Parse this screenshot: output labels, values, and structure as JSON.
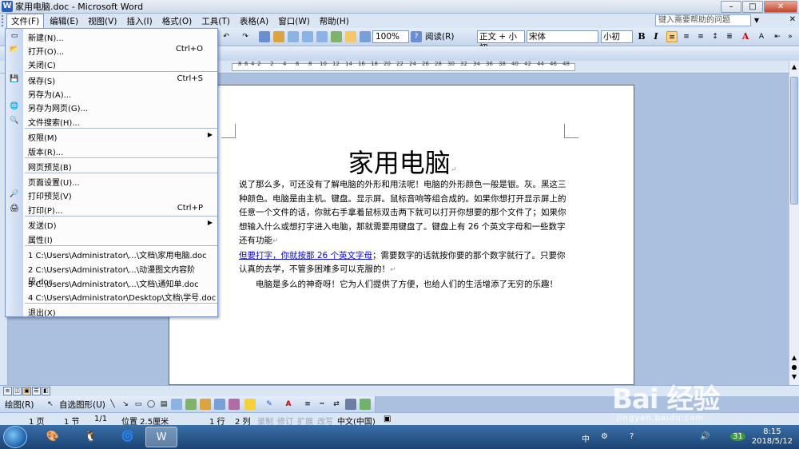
{
  "window": {
    "title": "家用电脑.doc - Microsoft Word",
    "app_icon": "W",
    "buttons": [
      "–",
      "□",
      "✕"
    ]
  },
  "menubar": {
    "items": [
      "文件(F)",
      "编辑(E)",
      "视图(V)",
      "插入(I)",
      "格式(O)",
      "工具(T)",
      "表格(A)",
      "窗口(W)",
      "帮助(H)"
    ],
    "help_placeholder": "键入需要帮助的问题"
  },
  "toolbar": {
    "zoom": "100%",
    "read_label": "阅读(R)",
    "style": "正文 + 小初",
    "font": "宋体",
    "size": "小初",
    "bold": "B",
    "italic": "I",
    "font_color": "A"
  },
  "file_menu": {
    "items": [
      {
        "label": "新建(N)...",
        "key": "",
        "icon": "new-document-icon",
        "glyph": "▭"
      },
      {
        "label": "打开(O)...",
        "key": "Ctrl+O",
        "icon": "open-folder-icon",
        "glyph": "📂"
      },
      {
        "label": "关闭(C)",
        "key": "",
        "icon": "",
        "glyph": ""
      },
      {
        "label": "保存(S)",
        "key": "Ctrl+S",
        "icon": "save-icon",
        "glyph": "💾"
      },
      {
        "label": "另存为(A)...",
        "key": "",
        "icon": "",
        "glyph": ""
      },
      {
        "label": "另存为网页(G)...",
        "key": "",
        "icon": "save-web-icon",
        "glyph": "🌐"
      },
      {
        "label": "文件搜索(H)...",
        "key": "",
        "icon": "file-search-icon",
        "glyph": "🔍"
      },
      {
        "label": "权限(M)",
        "key": "",
        "icon": "",
        "glyph": "",
        "submenu": true
      },
      {
        "label": "版本(R)...",
        "key": "",
        "icon": "",
        "glyph": ""
      },
      {
        "label": "网页预览(B)",
        "key": "",
        "icon": "",
        "glyph": ""
      },
      {
        "label": "页面设置(U)...",
        "key": "",
        "icon": "",
        "glyph": ""
      },
      {
        "label": "打印预览(V)",
        "key": "",
        "icon": "print-preview-icon",
        "glyph": "🔎"
      },
      {
        "label": "打印(P)...",
        "key": "Ctrl+P",
        "icon": "print-icon",
        "glyph": "🖨"
      },
      {
        "label": "发送(D)",
        "key": "",
        "icon": "",
        "glyph": "",
        "submenu": true
      },
      {
        "label": "属性(I)",
        "key": "",
        "icon": "",
        "glyph": ""
      },
      {
        "label": "1 C:\\Users\\Administrator\\...\\文档\\家用电脑.doc",
        "key": "",
        "icon": "",
        "glyph": ""
      },
      {
        "label": "2 C:\\Users\\Administrator\\...\\动漫图文内容阶段.doc",
        "key": "",
        "icon": "",
        "glyph": ""
      },
      {
        "label": "3 C:\\Users\\Administrator\\...\\文档\\通知单.doc",
        "key": "",
        "icon": "",
        "glyph": ""
      },
      {
        "label": "4 C:\\Users\\Administrator\\Desktop\\文档\\学号.doc",
        "key": "",
        "icon": "",
        "glyph": ""
      },
      {
        "label": "退出(X)",
        "key": "",
        "icon": "",
        "glyph": ""
      }
    ]
  },
  "ruler": {
    "numbers": [
      "8",
      "6",
      "4",
      "2",
      "2",
      "4",
      "6",
      "8",
      "10",
      "12",
      "14",
      "16",
      "18",
      "20",
      "22",
      "24",
      "26",
      "28",
      "30",
      "32",
      "34",
      "36",
      "38",
      "40",
      "42",
      "44",
      "46",
      "48"
    ]
  },
  "document": {
    "title": "家用电脑",
    "paragraph_1": "说了那么多，可还没有了解电脑的外形和用法呢！电脑的外形颜色一般是银。灰。黑这三种颜色。电脑是由主机。键盘。显示屏。鼠标音响等组合成的。如果你想打开显示屏上的任意一个文件的话，你就右手拿着鼠标双击两下就可以打开你想要的那个文件了；如果你想输入什么或想打字进入电脑，那就需要用键盘了。键盘上有 26 个英文字母和一些数字还有功能",
    "link_text": "但要打字，你就按那 26 个英文字母",
    "paragraph_2_rest": "；需要数字的话就按你要的那个数字就行了。只要你认真的去学，不管多困难多可以克服的！",
    "paragraph_3": "电脑是多么的神奇呀！它为人们提供了方便，也给人们的生活增添了无穷的乐趣！",
    "para_mark": "↵"
  },
  "drawbar": {
    "draw_label": "绘图(R)",
    "autoshape_label": "自选图形(U)"
  },
  "statusbar": {
    "page": "1 页",
    "section": "1 节",
    "pages": "1/1",
    "position": "位置 2.5厘米",
    "line": "1 行",
    "column": "2 列",
    "rec": "录制",
    "trk": "修订",
    "ext": "扩展",
    "ovr": "改写",
    "language": "中文(中国)"
  },
  "taskbar": {
    "ime": "中",
    "time": "8:15",
    "date": "2018/5/12",
    "badge": "31"
  },
  "watermark": {
    "logo_text": "Bai 经验",
    "url": "jingyan.baidu.com"
  }
}
